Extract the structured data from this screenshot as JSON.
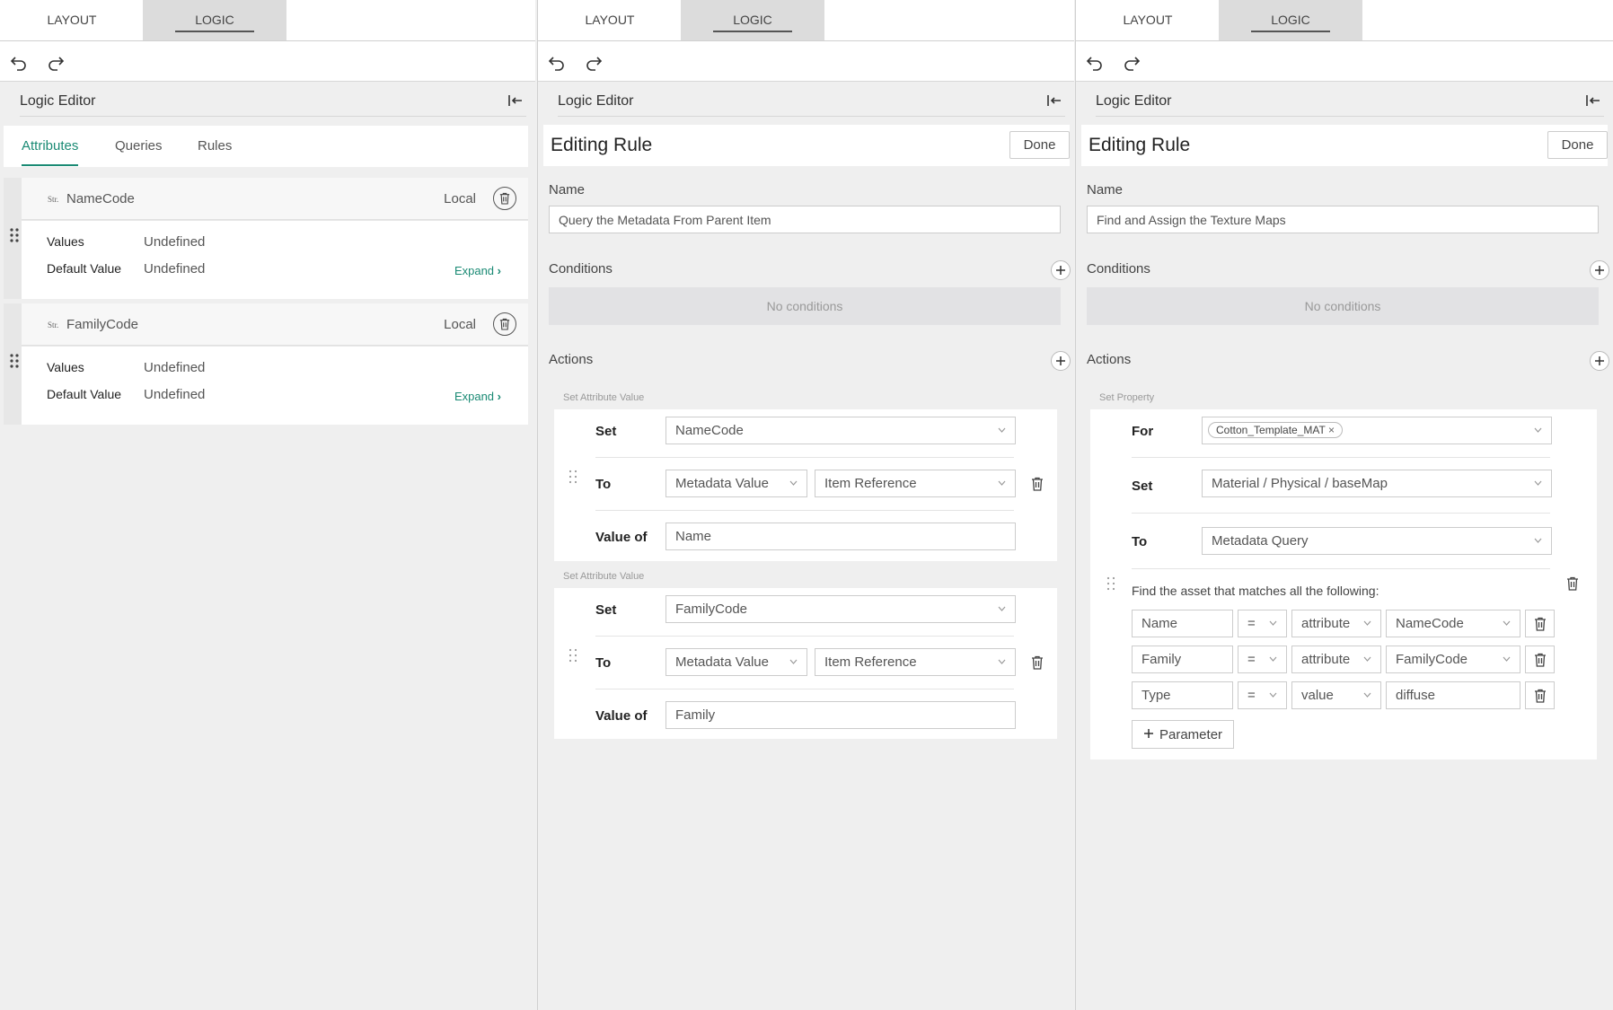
{
  "tabs": {
    "layout": "LAYOUT",
    "logic": "LOGIC"
  },
  "editor_title": "Logic Editor",
  "panel1": {
    "attr_tabs": [
      "Attributes",
      "Queries",
      "Rules"
    ],
    "attributes": [
      {
        "type": "Str.",
        "name": "NameCode",
        "scope": "Local",
        "values_label": "Values",
        "values": "Undefined",
        "default_label": "Default Value",
        "default": "Undefined",
        "expand": "Expand"
      },
      {
        "type": "Str.",
        "name": "FamilyCode",
        "scope": "Local",
        "values_label": "Values",
        "values": "Undefined",
        "default_label": "Default Value",
        "default": "Undefined",
        "expand": "Expand"
      }
    ]
  },
  "panel2": {
    "title": "Editing Rule",
    "done": "Done",
    "name_label": "Name",
    "name_value": "Query the Metadata From Parent Item",
    "conditions_label": "Conditions",
    "no_conditions": "No conditions",
    "actions_label": "Actions",
    "actions": [
      {
        "section": "Set Attribute Value",
        "set_label": "Set",
        "set": "NameCode",
        "to_label": "To",
        "to1": "Metadata Value",
        "to2": "Item Reference",
        "valueof_label": "Value of",
        "valueof": "Name"
      },
      {
        "section": "Set Attribute Value",
        "set_label": "Set",
        "set": "FamilyCode",
        "to_label": "To",
        "to1": "Metadata Value",
        "to2": "Item Reference",
        "valueof_label": "Value of",
        "valueof": "Family"
      }
    ]
  },
  "panel3": {
    "title": "Editing Rule",
    "done": "Done",
    "name_label": "Name",
    "name_value": "Find and Assign the Texture Maps",
    "conditions_label": "Conditions",
    "no_conditions": "No conditions",
    "actions_label": "Actions",
    "section": "Set Property",
    "for_label": "For",
    "for_chip": "Cotton_Template_MAT",
    "set_label": "Set",
    "set": "Material / Physical / baseMap",
    "to_label": "To",
    "to": "Metadata Query",
    "query_text": "Find the asset that matches all the following:",
    "params": [
      {
        "field": "Name",
        "op": "=",
        "kind": "attribute",
        "value": "NameCode"
      },
      {
        "field": "Family",
        "op": "=",
        "kind": "attribute",
        "value": "FamilyCode"
      },
      {
        "field": "Type",
        "op": "=",
        "kind": "value",
        "value": "diffuse"
      }
    ],
    "add_param": "Parameter"
  }
}
